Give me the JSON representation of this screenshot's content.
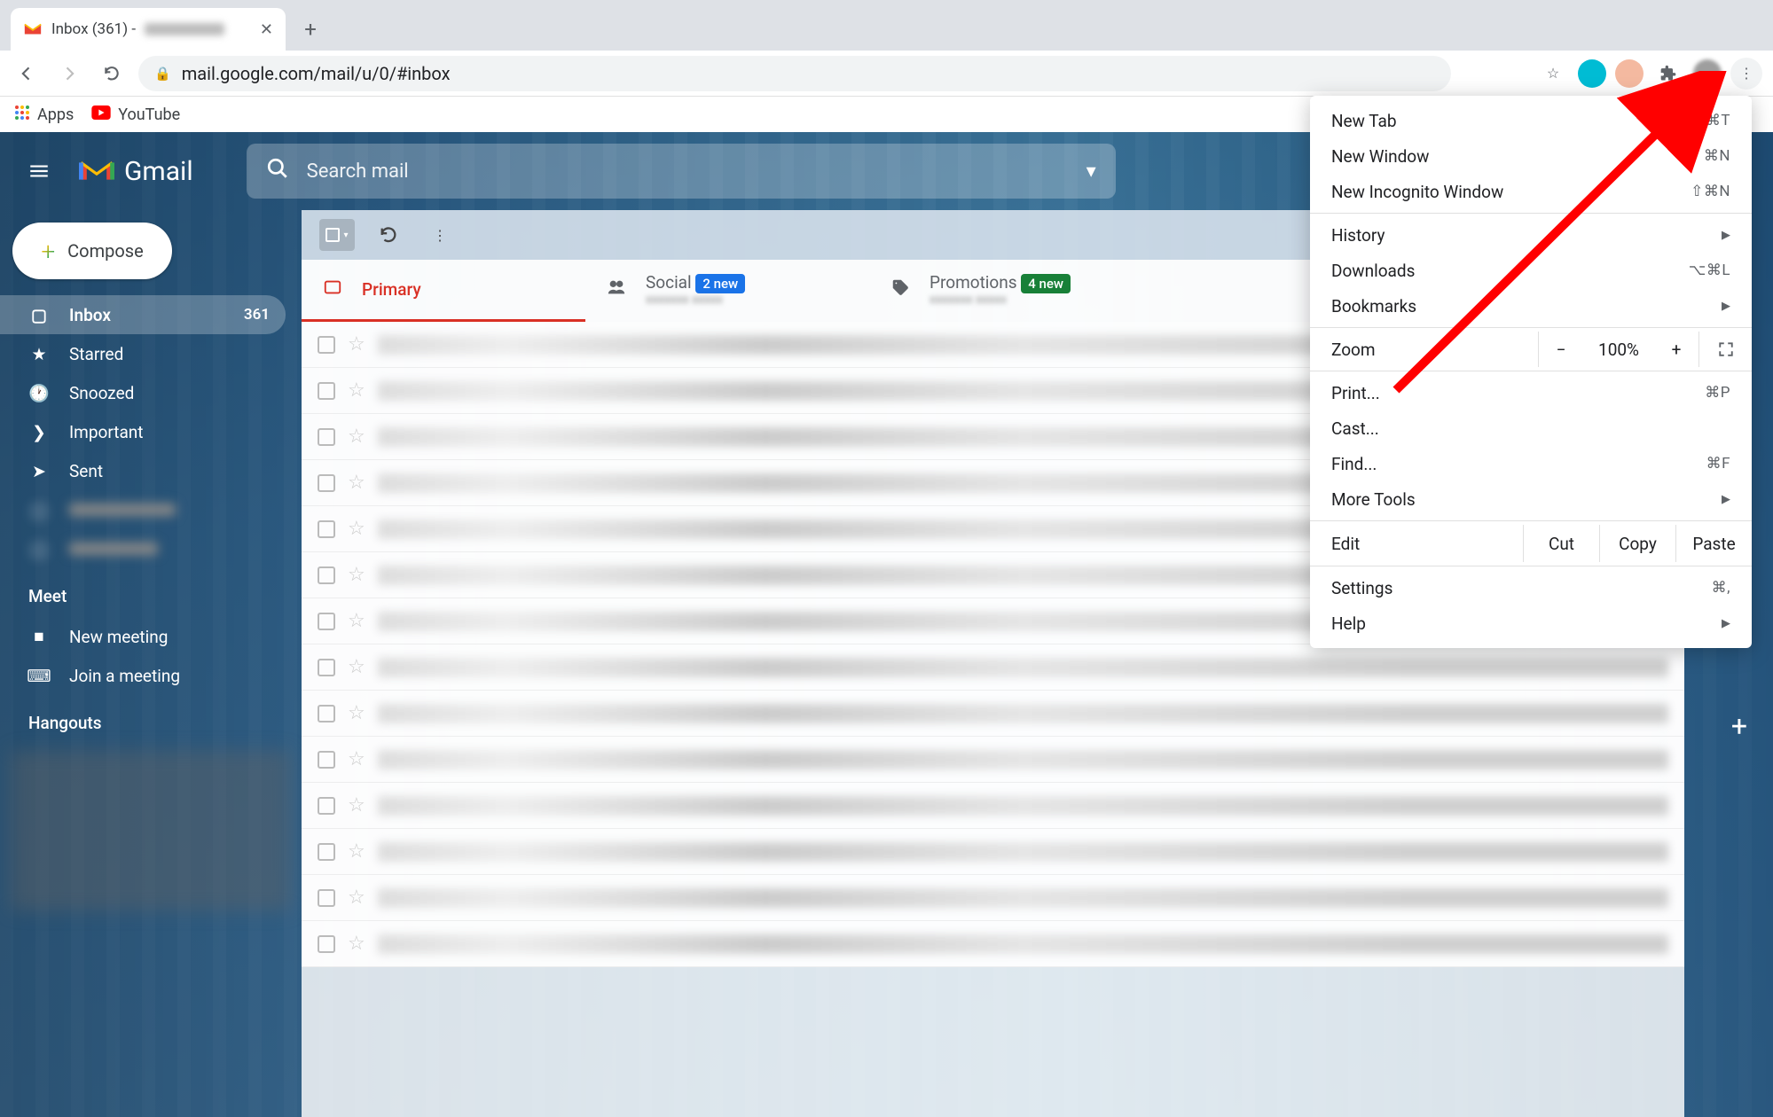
{
  "browser": {
    "tab_title": "Inbox (361) -",
    "url": "mail.google.com/mail/u/0/#inbox",
    "bookmarks": {
      "apps": "Apps",
      "youtube": "YouTube"
    }
  },
  "chrome_menu": {
    "new_tab": {
      "label": "New Tab",
      "shortcut": "⌘T"
    },
    "new_window": {
      "label": "New Window",
      "shortcut": "⌘N"
    },
    "incognito": {
      "label": "New Incognito Window",
      "shortcut": "⇧⌘N"
    },
    "history": {
      "label": "History"
    },
    "downloads": {
      "label": "Downloads",
      "shortcut": "⌥⌘L"
    },
    "bookmarks": {
      "label": "Bookmarks"
    },
    "zoom": {
      "label": "Zoom",
      "minus": "−",
      "value": "100%",
      "plus": "+"
    },
    "print": {
      "label": "Print...",
      "shortcut": "⌘P"
    },
    "cast": {
      "label": "Cast..."
    },
    "find": {
      "label": "Find...",
      "shortcut": "⌘F"
    },
    "more_tools": {
      "label": "More Tools"
    },
    "edit": {
      "label": "Edit",
      "cut": "Cut",
      "copy": "Copy",
      "paste": "Paste"
    },
    "settings": {
      "label": "Settings",
      "shortcut": "⌘,"
    },
    "help": {
      "label": "Help"
    }
  },
  "gmail": {
    "logo_text": "Gmail",
    "search_placeholder": "Search mail",
    "compose": "Compose",
    "nav": {
      "inbox": {
        "label": "Inbox",
        "count": "361"
      },
      "starred": "Starred",
      "snoozed": "Snoozed",
      "important": "Important",
      "sent": "Sent"
    },
    "meet": {
      "heading": "Meet",
      "new_meeting": "New meeting",
      "join": "Join a meeting"
    },
    "hangouts_heading": "Hangouts",
    "tabs": {
      "primary": "Primary",
      "social": {
        "label": "Social",
        "badge": "2 new"
      },
      "promotions": {
        "label": "Promotions",
        "badge": "4 new"
      }
    }
  }
}
